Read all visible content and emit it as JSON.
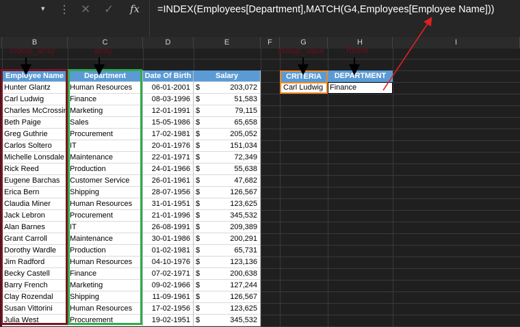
{
  "formula_bar": {
    "namebox_arrow": "▾",
    "dots": "⋮",
    "cancel_icon": "✕",
    "enter_icon": "✓",
    "fx_label": "fx",
    "formula": "=INDEX(Employees[Department],MATCH(G4,Employees[Employee Name]))"
  },
  "columns": [
    "B",
    "C",
    "D",
    "E",
    "F",
    "G",
    "H",
    "I"
  ],
  "annotations": {
    "lookup_array": "lookup_array",
    "array": "array",
    "lookup_value": "lookup_value",
    "result": "Result"
  },
  "table": {
    "headers": [
      "Employee Name",
      "Department",
      "Date Of Birth",
      "Salary"
    ],
    "currency_symbol": "$",
    "rows": [
      [
        "Hunter Glantz",
        "Human Resources",
        "06-01-2001",
        "203,072"
      ],
      [
        "Carl Ludwig",
        "Finance",
        "08-03-1996",
        "51,583"
      ],
      [
        "Charles McCrossin",
        "Marketing",
        "12-01-1991",
        "79,115"
      ],
      [
        "Beth Paige",
        "Sales",
        "15-05-1986",
        "65,658"
      ],
      [
        "Greg Guthrie",
        "Procurement",
        "17-02-1981",
        "205,052"
      ],
      [
        "Carlos Soltero",
        "IT",
        "20-01-1976",
        "151,034"
      ],
      [
        "Michelle Lonsdale",
        "Maintenance",
        "22-01-1971",
        "72,349"
      ],
      [
        "Rick Reed",
        "Production",
        "24-01-1966",
        "55,638"
      ],
      [
        "Eugene Barchas",
        "Customer Service",
        "26-01-1961",
        "47,682"
      ],
      [
        "Erica Bern",
        "Shipping",
        "28-07-1956",
        "126,567"
      ],
      [
        "Claudia Miner",
        "Human Resources",
        "31-01-1951",
        "123,625"
      ],
      [
        "Jack Lebron",
        "Procurement",
        "21-01-1996",
        "345,532"
      ],
      [
        "Alan Barnes",
        "IT",
        "26-08-1991",
        "209,389"
      ],
      [
        "Grant Carroll",
        "Maintenance",
        "30-01-1986",
        "200,291"
      ],
      [
        "Dorothy Wardle",
        "Production",
        "01-02-1981",
        "65,731"
      ],
      [
        "Jim Radford",
        "Human Resources",
        "04-10-1976",
        "123,136"
      ],
      [
        "Becky Castell",
        "Finance",
        "07-02-1971",
        "200,638"
      ],
      [
        "Barry French",
        "Marketing",
        "09-02-1966",
        "127,244"
      ],
      [
        "Clay Rozendal",
        "Shipping",
        "11-09-1961",
        "126,567"
      ],
      [
        "Susan Vittorini",
        "Human Resources",
        "17-02-1956",
        "123,625"
      ],
      [
        "Julia West",
        "Procurement",
        "19-02-1951",
        "345,532"
      ]
    ]
  },
  "criteria": {
    "criteria_header": "CRITERIA",
    "department_header": "DEPARTMENT",
    "criteria_value": "Carl Ludwig",
    "department_value": "Finance"
  },
  "colors": {
    "header_blue": "#5b9bd5",
    "lookup_box": "#7a1421",
    "array_box": "#2eaa4a",
    "criteria_box": "#f08a24",
    "arrow_red": "#e02020"
  }
}
